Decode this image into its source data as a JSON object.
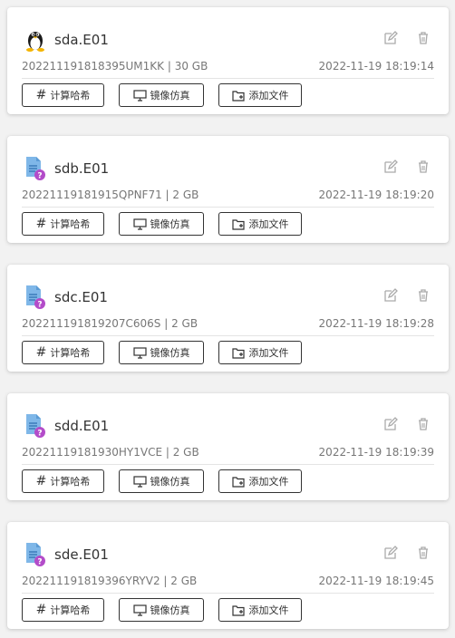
{
  "colors": {
    "card_bg": "#ffffff",
    "page_bg": "#f2f2f2",
    "text": "#333333",
    "muted": "#777777",
    "doc_icon": "#7fb7e8",
    "badge": "#b34cc9"
  },
  "cards": [
    {
      "icon": "linux-penguin-icon",
      "name": "sda.E01",
      "meta": "20221119181839 5UM1KK | 30 GB",
      "id_size": "202211191818395UM1KK | 30 GB",
      "timestamp": "2022-11-19 18:19:14",
      "buttons": {
        "hash": "计算哈希",
        "mirror": "镜像仿真",
        "add_file": "添加文件"
      }
    },
    {
      "icon": "unknown-document-icon",
      "name": "sdb.E01",
      "id_size": "20221119181915QPNF71 | 2 GB",
      "timestamp": "2022-11-19 18:19:20",
      "buttons": {
        "hash": "计算哈希",
        "mirror": "镜像仿真",
        "add_file": "添加文件"
      }
    },
    {
      "icon": "unknown-document-icon",
      "name": "sdc.E01",
      "id_size": "202211191819207C606S | 2 GB",
      "timestamp": "2022-11-19 18:19:28",
      "buttons": {
        "hash": "计算哈希",
        "mirror": "镜像仿真",
        "add_file": "添加文件"
      }
    },
    {
      "icon": "unknown-document-icon",
      "name": "sdd.E01",
      "id_size": "20221119181930HY1VCE | 2 GB",
      "timestamp": "2022-11-19 18:19:39",
      "buttons": {
        "hash": "计算哈希",
        "mirror": "镜像仿真",
        "add_file": "添加文件"
      }
    },
    {
      "icon": "unknown-document-icon",
      "name": "sde.E01",
      "id_size": "202211191819396YRYV2 | 2 GB",
      "timestamp": "2022-11-19 18:19:45",
      "buttons": {
        "hash": "计算哈希",
        "mirror": "镜像仿真",
        "add_file": "添加文件"
      }
    }
  ]
}
